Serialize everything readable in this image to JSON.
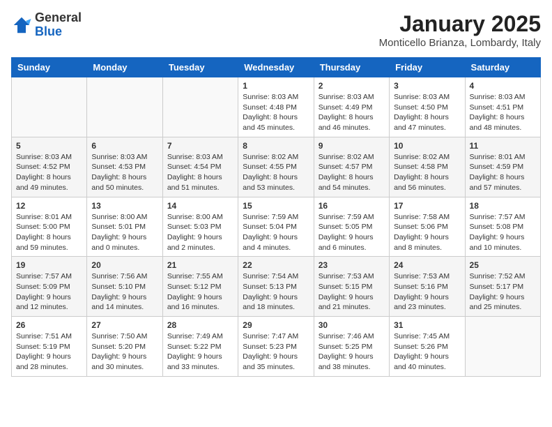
{
  "header": {
    "logo_general": "General",
    "logo_blue": "Blue",
    "title": "January 2025",
    "subtitle": "Monticello Brianza, Lombardy, Italy"
  },
  "days_of_week": [
    "Sunday",
    "Monday",
    "Tuesday",
    "Wednesday",
    "Thursday",
    "Friday",
    "Saturday"
  ],
  "weeks": [
    [
      {
        "day": "",
        "info": ""
      },
      {
        "day": "",
        "info": ""
      },
      {
        "day": "",
        "info": ""
      },
      {
        "day": "1",
        "info": "Sunrise: 8:03 AM\nSunset: 4:48 PM\nDaylight: 8 hours\nand 45 minutes."
      },
      {
        "day": "2",
        "info": "Sunrise: 8:03 AM\nSunset: 4:49 PM\nDaylight: 8 hours\nand 46 minutes."
      },
      {
        "day": "3",
        "info": "Sunrise: 8:03 AM\nSunset: 4:50 PM\nDaylight: 8 hours\nand 47 minutes."
      },
      {
        "day": "4",
        "info": "Sunrise: 8:03 AM\nSunset: 4:51 PM\nDaylight: 8 hours\nand 48 minutes."
      }
    ],
    [
      {
        "day": "5",
        "info": "Sunrise: 8:03 AM\nSunset: 4:52 PM\nDaylight: 8 hours\nand 49 minutes."
      },
      {
        "day": "6",
        "info": "Sunrise: 8:03 AM\nSunset: 4:53 PM\nDaylight: 8 hours\nand 50 minutes."
      },
      {
        "day": "7",
        "info": "Sunrise: 8:03 AM\nSunset: 4:54 PM\nDaylight: 8 hours\nand 51 minutes."
      },
      {
        "day": "8",
        "info": "Sunrise: 8:02 AM\nSunset: 4:55 PM\nDaylight: 8 hours\nand 53 minutes."
      },
      {
        "day": "9",
        "info": "Sunrise: 8:02 AM\nSunset: 4:57 PM\nDaylight: 8 hours\nand 54 minutes."
      },
      {
        "day": "10",
        "info": "Sunrise: 8:02 AM\nSunset: 4:58 PM\nDaylight: 8 hours\nand 56 minutes."
      },
      {
        "day": "11",
        "info": "Sunrise: 8:01 AM\nSunset: 4:59 PM\nDaylight: 8 hours\nand 57 minutes."
      }
    ],
    [
      {
        "day": "12",
        "info": "Sunrise: 8:01 AM\nSunset: 5:00 PM\nDaylight: 8 hours\nand 59 minutes."
      },
      {
        "day": "13",
        "info": "Sunrise: 8:00 AM\nSunset: 5:01 PM\nDaylight: 9 hours\nand 0 minutes."
      },
      {
        "day": "14",
        "info": "Sunrise: 8:00 AM\nSunset: 5:03 PM\nDaylight: 9 hours\nand 2 minutes."
      },
      {
        "day": "15",
        "info": "Sunrise: 7:59 AM\nSunset: 5:04 PM\nDaylight: 9 hours\nand 4 minutes."
      },
      {
        "day": "16",
        "info": "Sunrise: 7:59 AM\nSunset: 5:05 PM\nDaylight: 9 hours\nand 6 minutes."
      },
      {
        "day": "17",
        "info": "Sunrise: 7:58 AM\nSunset: 5:06 PM\nDaylight: 9 hours\nand 8 minutes."
      },
      {
        "day": "18",
        "info": "Sunrise: 7:57 AM\nSunset: 5:08 PM\nDaylight: 9 hours\nand 10 minutes."
      }
    ],
    [
      {
        "day": "19",
        "info": "Sunrise: 7:57 AM\nSunset: 5:09 PM\nDaylight: 9 hours\nand 12 minutes."
      },
      {
        "day": "20",
        "info": "Sunrise: 7:56 AM\nSunset: 5:10 PM\nDaylight: 9 hours\nand 14 minutes."
      },
      {
        "day": "21",
        "info": "Sunrise: 7:55 AM\nSunset: 5:12 PM\nDaylight: 9 hours\nand 16 minutes."
      },
      {
        "day": "22",
        "info": "Sunrise: 7:54 AM\nSunset: 5:13 PM\nDaylight: 9 hours\nand 18 minutes."
      },
      {
        "day": "23",
        "info": "Sunrise: 7:53 AM\nSunset: 5:15 PM\nDaylight: 9 hours\nand 21 minutes."
      },
      {
        "day": "24",
        "info": "Sunrise: 7:53 AM\nSunset: 5:16 PM\nDaylight: 9 hours\nand 23 minutes."
      },
      {
        "day": "25",
        "info": "Sunrise: 7:52 AM\nSunset: 5:17 PM\nDaylight: 9 hours\nand 25 minutes."
      }
    ],
    [
      {
        "day": "26",
        "info": "Sunrise: 7:51 AM\nSunset: 5:19 PM\nDaylight: 9 hours\nand 28 minutes."
      },
      {
        "day": "27",
        "info": "Sunrise: 7:50 AM\nSunset: 5:20 PM\nDaylight: 9 hours\nand 30 minutes."
      },
      {
        "day": "28",
        "info": "Sunrise: 7:49 AM\nSunset: 5:22 PM\nDaylight: 9 hours\nand 33 minutes."
      },
      {
        "day": "29",
        "info": "Sunrise: 7:47 AM\nSunset: 5:23 PM\nDaylight: 9 hours\nand 35 minutes."
      },
      {
        "day": "30",
        "info": "Sunrise: 7:46 AM\nSunset: 5:25 PM\nDaylight: 9 hours\nand 38 minutes."
      },
      {
        "day": "31",
        "info": "Sunrise: 7:45 AM\nSunset: 5:26 PM\nDaylight: 9 hours\nand 40 minutes."
      },
      {
        "day": "",
        "info": ""
      }
    ]
  ]
}
